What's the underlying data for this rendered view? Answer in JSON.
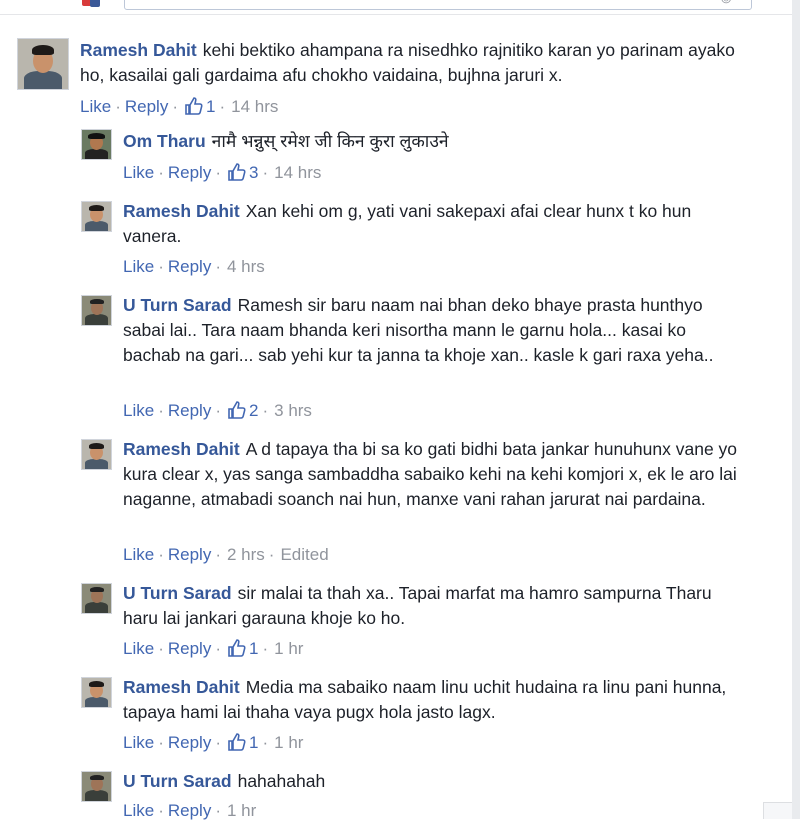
{
  "comments": [
    {
      "author": "Ramesh Dahit",
      "text": "kehi bektiko ahampana ra nisedhko rajnitiko karan yo parinam ayako ho, kasailai gali gardaima afu chokho vaidaina, bujhna jaruri x.",
      "like": "Like",
      "reply": "Reply",
      "likes": "1",
      "time": "14 hrs"
    },
    {
      "author": "Om Tharu",
      "text": "नामै भन्नुस् रमेश जी किन कुरा लुकाउने",
      "like": "Like",
      "reply": "Reply",
      "likes": "3",
      "time": "14 hrs"
    },
    {
      "author": "Ramesh Dahit",
      "text": "Xan kehi om g, yati vani sakepaxi afai clear hunx t ko hun vanera.",
      "like": "Like",
      "reply": "Reply",
      "time": "4 hrs"
    },
    {
      "author": "U Turn Sarad",
      "text": "Ramesh sir baru naam nai bhan deko bhaye prasta hunthyo sabai lai.. Tara naam bhanda keri nisortha mann le garnu hola... kasai ko bachab na gari... sab yehi kur ta janna ta khoje xan.. kasle k gari raxa yeha..",
      "like": "Like",
      "reply": "Reply",
      "likes": "2",
      "time": "3 hrs"
    },
    {
      "author": "Ramesh Dahit",
      "text": "A d tapaya tha bi sa ko gati bidhi bata jankar hunuhunx vane yo kura clear x, yas sanga sambaddha sabaiko kehi na kehi komjori x, ek le aro lai naganne, atmabadi soanch nai hun, manxe vani rahan jarurat nai pardaina.",
      "like": "Like",
      "reply": "Reply",
      "time": "2 hrs",
      "edited": "Edited"
    },
    {
      "author": "U Turn Sarad",
      "text": "sir malai ta thah xa.. Tapai marfat ma hamro sampurna Tharu haru lai jankari garauna khoje ko ho.",
      "like": "Like",
      "reply": "Reply",
      "likes": "1",
      "time": "1 hr"
    },
    {
      "author": "Ramesh Dahit",
      "text": "Media ma sabaiko naam linu uchit hudaina ra linu pani hunna, tapaya hami lai thaha vaya pugx hola jasto lagx.",
      "like": "Like",
      "reply": "Reply",
      "likes": "1",
      "time": "1 hr"
    },
    {
      "author": "U Turn Sarad",
      "text": "hahahahah",
      "like": "Like",
      "reply": "Reply",
      "time": "1 hr"
    }
  ],
  "colors": {
    "author": "#365899",
    "link": "#4267b2",
    "meta": "#90949c",
    "text": "#1d2129"
  },
  "icons": {
    "like": "thumbs-up-icon",
    "emoji": "emoji-icon"
  }
}
